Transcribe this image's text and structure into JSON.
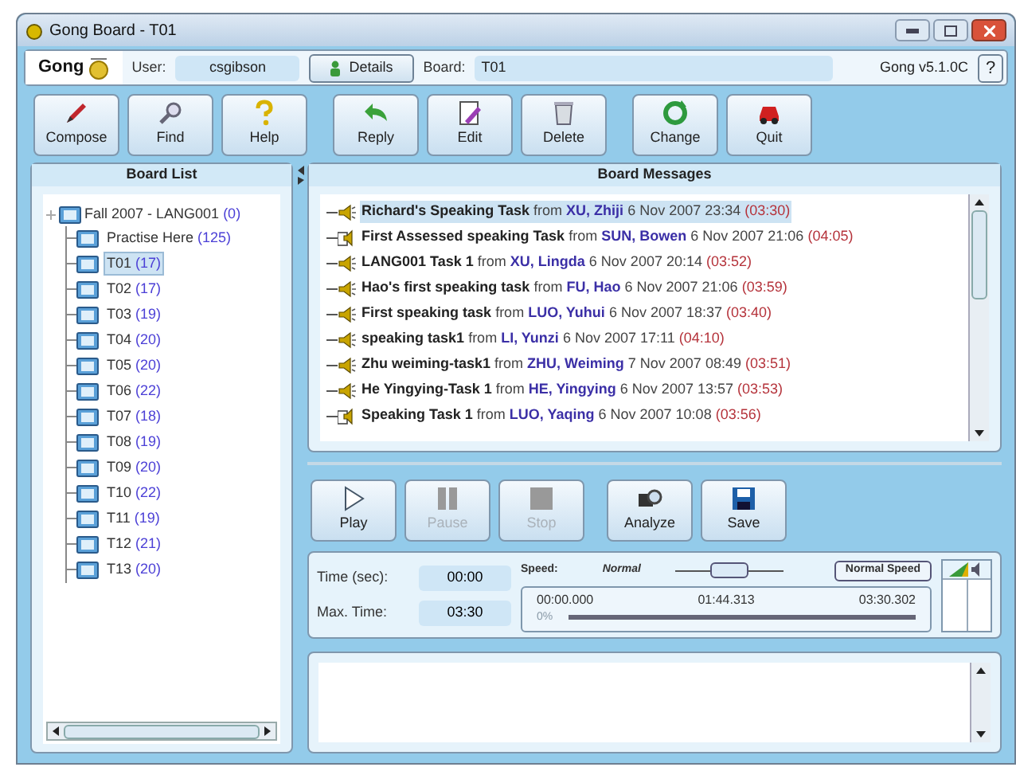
{
  "window": {
    "title": "Gong Board - T01"
  },
  "header": {
    "logo": "Gong",
    "user_label": "User:",
    "user": "csgibson",
    "details_button": "Details",
    "board_label": "Board:",
    "board": "T01",
    "version": "Gong v5.1.0C",
    "help_button": "?"
  },
  "toolbar": [
    [
      {
        "label": "Compose",
        "kind": "pencil"
      },
      {
        "label": "Find",
        "kind": "find"
      },
      {
        "label": "Help",
        "kind": "help"
      }
    ],
    [
      {
        "label": "Reply",
        "kind": "reply"
      },
      {
        "label": "Edit",
        "kind": "edit"
      },
      {
        "label": "Delete",
        "kind": "delete"
      }
    ],
    [
      {
        "label": "Change",
        "kind": "change"
      },
      {
        "label": "Quit",
        "kind": "quit"
      }
    ]
  ],
  "board_list": {
    "title": "Board List",
    "root": {
      "label": "Fall 2007 - LANG001",
      "count": "(0)",
      "expanded": true,
      "children": [
        {
          "label": "Practise Here",
          "count": "(125)",
          "selected": false
        },
        {
          "label": "T01",
          "count": "(17)",
          "selected": true
        },
        {
          "label": "T02",
          "count": "(17)",
          "selected": false
        },
        {
          "label": "T03",
          "count": "(19)",
          "selected": false
        },
        {
          "label": "T04",
          "count": "(20)",
          "selected": false
        },
        {
          "label": "T05",
          "count": "(20)",
          "selected": false
        },
        {
          "label": "T06",
          "count": "(22)",
          "selected": false
        },
        {
          "label": "T07",
          "count": "(18)",
          "selected": false
        },
        {
          "label": "T08",
          "count": "(19)",
          "selected": false
        },
        {
          "label": "T09",
          "count": "(20)",
          "selected": false
        },
        {
          "label": "T10",
          "count": "(22)",
          "selected": false
        },
        {
          "label": "T11",
          "count": "(19)",
          "selected": false
        },
        {
          "label": "T12",
          "count": "(21)",
          "selected": false
        },
        {
          "label": "T13",
          "count": "(20)",
          "selected": false
        }
      ]
    }
  },
  "board_messages": {
    "title": "Board Messages",
    "messages": [
      {
        "title": "Richard's Speaking Task",
        "from": "from",
        "author": "XU, Zhiji",
        "date": "6 Nov 2007 23:34",
        "duration": "(03:30)",
        "kind": "audio",
        "selected": true
      },
      {
        "title": "First Assessed speaking Task",
        "from": "from",
        "author": "SUN, Bowen",
        "date": "6 Nov 2007 21:06",
        "duration": "(04:05)",
        "kind": "assessed",
        "selected": false
      },
      {
        "title": "LANG001 Task 1",
        "from": "from",
        "author": "XU, Lingda",
        "date": "6 Nov 2007 20:14",
        "duration": "(03:52)",
        "kind": "audio",
        "selected": false
      },
      {
        "title": "Hao's first speaking task",
        "from": "from",
        "author": "FU, Hao",
        "date": "6 Nov 2007 21:06",
        "duration": "(03:59)",
        "kind": "audio",
        "selected": false
      },
      {
        "title": "First speaking task",
        "from": "from",
        "author": "LUO, Yuhui",
        "date": "6 Nov 2007 18:37",
        "duration": "(03:40)",
        "kind": "audio",
        "selected": false
      },
      {
        "title": "speaking task1",
        "from": "from",
        "author": "LI, Yunzi",
        "date": "6 Nov 2007 17:11",
        "duration": "(04:10)",
        "kind": "audio",
        "selected": false
      },
      {
        "title": "Zhu weiming-task1",
        "from": "from",
        "author": "ZHU, Weiming",
        "date": "7 Nov 2007 08:49",
        "duration": "(03:51)",
        "kind": "audio",
        "selected": false
      },
      {
        "title": "He Yingying-Task 1",
        "from": "from",
        "author": "HE, Yingying",
        "date": "6 Nov 2007 13:57",
        "duration": "(03:53)",
        "kind": "audio",
        "selected": false
      },
      {
        "title": "Speaking Task 1",
        "from": "from",
        "author": "LUO, Yaqing",
        "date": "6 Nov 2007 10:08",
        "duration": "(03:56)",
        "kind": "assessed",
        "selected": false
      }
    ]
  },
  "player": {
    "buttons": [
      [
        {
          "label": "Play",
          "kind": "play",
          "disabled": false
        },
        {
          "label": "Pause",
          "kind": "pause",
          "disabled": true
        },
        {
          "label": "Stop",
          "kind": "stop",
          "disabled": true
        }
      ],
      [
        {
          "label": "Analyze",
          "kind": "analyze",
          "disabled": false
        },
        {
          "label": "Save",
          "kind": "save",
          "disabled": false
        }
      ]
    ],
    "time_label": "Time (sec):",
    "time": "00:00",
    "max_label": "Max. Time:",
    "max_time": "03:30",
    "speed_label": "Speed:",
    "speed_value": "Normal",
    "speed": {
      "level": 0.5
    },
    "normal_speed_button": "Normal Speed",
    "timeline": {
      "start": "00:00.000",
      "middle": "01:44.313",
      "end": "03:30.302",
      "percent": "0%",
      "level": 0
    }
  }
}
